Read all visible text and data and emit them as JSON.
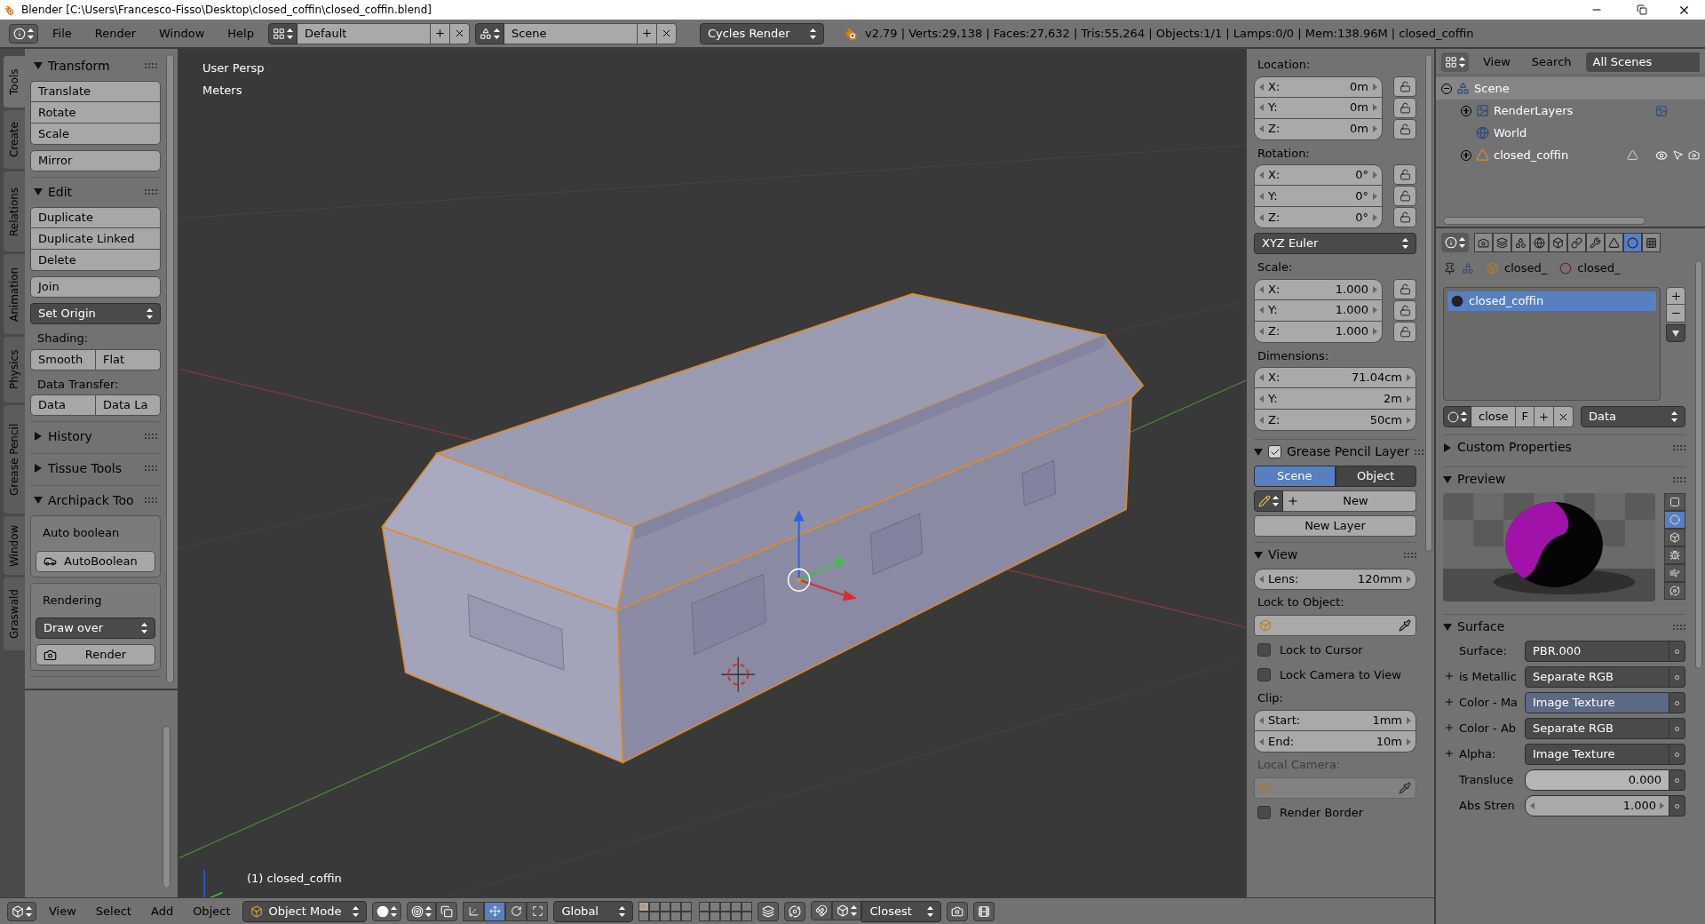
{
  "window": {
    "title": "Blender [C:\\Users\\Francesco-Fisso\\Desktop\\closed_coffin\\closed_coffin.blend]"
  },
  "info_header": {
    "menus": [
      "File",
      "Render",
      "Window",
      "Help"
    ],
    "layout": "Default",
    "scene": "Scene",
    "engine": "Cycles Render",
    "stats": "v2.79 | Verts:29,138 | Faces:27,632 | Tris:55,264 | Objects:1/1 | Lamps:0/0 | Mem:138.96M | closed_coffin"
  },
  "tool_tabs": [
    {
      "label": "Tools",
      "selected": true
    },
    {
      "label": "Create",
      "selected": false
    },
    {
      "label": "Relations",
      "selected": false
    },
    {
      "label": "Animation",
      "selected": false
    },
    {
      "label": "Physics",
      "selected": false
    },
    {
      "label": "Grease Pencil",
      "selected": false
    },
    {
      "label": "Window",
      "selected": false
    },
    {
      "label": "Graswald",
      "selected": false
    }
  ],
  "tool_panels": [
    {
      "title": "Transform",
      "expanded": true,
      "items": [
        {
          "kind": "stack",
          "labels": [
            "Translate",
            "Rotate",
            "Scale"
          ]
        },
        {
          "kind": "stack",
          "labels": [
            "Mirror"
          ]
        }
      ]
    },
    {
      "title": "Edit",
      "expanded": true,
      "items": [
        {
          "kind": "stack",
          "labels": [
            "Duplicate",
            "Duplicate Linked",
            "Delete"
          ]
        },
        {
          "kind": "stack",
          "labels": [
            "Join"
          ]
        },
        {
          "kind": "dropdown",
          "value": "Set Origin"
        },
        {
          "kind": "label",
          "text": "Shading:"
        },
        {
          "kind": "row",
          "labels": [
            "Smooth",
            "Flat"
          ]
        },
        {
          "kind": "label",
          "text": "Data Transfer:"
        },
        {
          "kind": "row",
          "labels": [
            "Data",
            "Data La"
          ]
        }
      ]
    },
    {
      "title": "History",
      "expanded": false
    },
    {
      "title": "Tissue Tools",
      "expanded": false
    },
    {
      "title": "Archipack Too",
      "expanded": true,
      "items": [
        {
          "kind": "box",
          "title": "Auto boolean",
          "button": "AutoBoolean"
        },
        {
          "kind": "box",
          "title": "Rendering",
          "dropdown": "Draw over",
          "button": "Render"
        }
      ]
    }
  ],
  "viewport": {
    "view_name": "User Persp",
    "units": "Meters",
    "object_label": "(1) closed_coffin"
  },
  "n_panel": {
    "groups": [
      {
        "label": "Location:",
        "locks": true,
        "fields": [
          {
            "axis": "X:",
            "value": "0m"
          },
          {
            "axis": "Y:",
            "value": "0m"
          },
          {
            "axis": "Z:",
            "value": "0m"
          }
        ]
      },
      {
        "label": "Rotation:",
        "locks": true,
        "fields": [
          {
            "axis": "X:",
            "value": "0°"
          },
          {
            "axis": "Y:",
            "value": "0°"
          },
          {
            "axis": "Z:",
            "value": "0°"
          }
        ],
        "mode": "XYZ Euler"
      },
      {
        "label": "Scale:",
        "locks": true,
        "fields": [
          {
            "axis": "X:",
            "value": "1.000"
          },
          {
            "axis": "Y:",
            "value": "1.000"
          },
          {
            "axis": "Z:",
            "value": "1.000"
          }
        ]
      },
      {
        "label": "Dimensions:",
        "locks": false,
        "fields": [
          {
            "axis": "X:",
            "value": "71.04cm"
          },
          {
            "axis": "Y:",
            "value": "2m"
          },
          {
            "axis": "Z:",
            "value": "50cm"
          }
        ]
      }
    ],
    "grease_pencil": {
      "title": "Grease Pencil Layer",
      "enabled": true,
      "expanded": true,
      "sources": [
        {
          "label": "Scene",
          "selected": true
        },
        {
          "label": "Object",
          "selected": false
        }
      ],
      "new_button": "New",
      "new_layer_button": "New Layer"
    },
    "view": {
      "title": "View",
      "expanded": true,
      "lens_label": "Lens:",
      "lens": "120mm",
      "lock_object_label": "Lock to Object:",
      "checks": [
        {
          "label": "Lock to Cursor",
          "checked": false
        },
        {
          "label": "Lock Camera to View",
          "checked": false
        }
      ],
      "clip_label": "Clip:",
      "clip": [
        {
          "label": "Start:",
          "value": "1mm"
        },
        {
          "label": "End:",
          "value": "10m"
        }
      ],
      "local_camera": {
        "label": "Local Camera:",
        "disabled": true
      },
      "render_border": {
        "label": "Render Border",
        "checked": false
      }
    }
  },
  "outliner": {
    "menus": [
      "View",
      "Search"
    ],
    "filter": "All Scenes",
    "tree": [
      {
        "label": "Scene",
        "kind": "scene",
        "expanded": true,
        "selected": true,
        "children": [
          {
            "label": "RenderLayers",
            "kind": "renderlayers",
            "expanded": false,
            "selected": false
          },
          {
            "label": "World",
            "kind": "world",
            "selected": false
          },
          {
            "label": "closed_coffin",
            "kind": "mesh",
            "expanded": false,
            "selected": false
          }
        ]
      }
    ]
  },
  "properties": {
    "tabs": [
      {
        "kind": "render",
        "selected": false
      },
      {
        "kind": "layers",
        "selected": false
      },
      {
        "kind": "scene",
        "selected": false
      },
      {
        "kind": "world",
        "selected": false
      },
      {
        "kind": "object",
        "selected": false
      },
      {
        "kind": "constraints",
        "selected": false
      },
      {
        "kind": "modifiers",
        "selected": false
      },
      {
        "kind": "data",
        "selected": false
      },
      {
        "kind": "material",
        "selected": true
      },
      {
        "kind": "texture",
        "selected": false
      }
    ],
    "breadcrumb": [
      "closed_",
      "closed_"
    ],
    "slots": [
      {
        "name": "closed_coffin",
        "selected": true
      }
    ],
    "datablock": {
      "name": "close",
      "fake_user": "F",
      "link": "Data"
    },
    "panels": [
      {
        "title": "Custom Properties",
        "expanded": false
      },
      {
        "title": "Preview",
        "kind": "preview",
        "expanded": true
      },
      {
        "title": "Surface",
        "kind": "surface",
        "expanded": true
      }
    ],
    "preview_shapes": [
      {
        "kind": "plane",
        "selected": false
      },
      {
        "kind": "sphere",
        "selected": true
      },
      {
        "kind": "cube",
        "selected": false
      },
      {
        "kind": "monkey",
        "selected": false
      },
      {
        "kind": "hair",
        "selected": false
      },
      {
        "kind": "world",
        "selected": false
      }
    ],
    "surface": [
      {
        "label": "Surface:",
        "value": "PBR.000",
        "kind": "link",
        "socket": false,
        "selected": false
      },
      {
        "label": "is Metallic",
        "value": "Separate RGB",
        "kind": "link",
        "socket": true,
        "selected": false
      },
      {
        "label": "Color - Ma",
        "value": "Image Texture",
        "kind": "link",
        "socket": true,
        "selected": true
      },
      {
        "label": "Color - Ab",
        "value": "Separate RGB",
        "kind": "link",
        "socket": true,
        "selected": false
      },
      {
        "label": "Alpha:",
        "value": "Image Texture",
        "kind": "link",
        "socket": true,
        "selected": false
      },
      {
        "label": "Transluce",
        "value": "0.000",
        "kind": "slider",
        "socket": false,
        "selected": false
      },
      {
        "label": "Abs Stren",
        "value": "1.000",
        "kind": "number",
        "socket": false,
        "selected": false
      }
    ]
  },
  "view3d_header": {
    "menus": [
      "View",
      "Select",
      "Add",
      "Object"
    ],
    "mode": "Object Mode",
    "manipulators": [
      {
        "kind": "widget",
        "selected": false
      },
      {
        "kind": "translate",
        "selected": true
      },
      {
        "kind": "rotate",
        "selected": false
      },
      {
        "kind": "scale",
        "selected": false
      }
    ],
    "orientation": "Global",
    "layers": [
      {
        "selected": true,
        "has_objects": true
      },
      {
        "selected": false,
        "has_objects": false
      },
      {
        "selected": false,
        "has_objects": false
      },
      {
        "selected": false,
        "has_objects": false
      },
      {
        "selected": false,
        "has_objects": false
      },
      {
        "selected": false,
        "has_objects": false
      },
      {
        "selected": false,
        "has_objects": false
      },
      {
        "selected": false,
        "has_objects": false
      },
      {
        "selected": false,
        "has_objects": false
      },
      {
        "selected": false,
        "has_objects": false
      },
      {
        "selected": false,
        "has_objects": false
      },
      {
        "selected": false,
        "has_objects": false
      },
      {
        "selected": false,
        "has_objects": false
      },
      {
        "selected": false,
        "has_objects": false
      },
      {
        "selected": false,
        "has_objects": false
      },
      {
        "selected": false,
        "has_objects": false
      },
      {
        "selected": false,
        "has_objects": false
      },
      {
        "selected": false,
        "has_objects": false
      },
      {
        "selected": false,
        "has_objects": false
      },
      {
        "selected": false,
        "has_objects": false
      }
    ],
    "snap": "Closest"
  }
}
